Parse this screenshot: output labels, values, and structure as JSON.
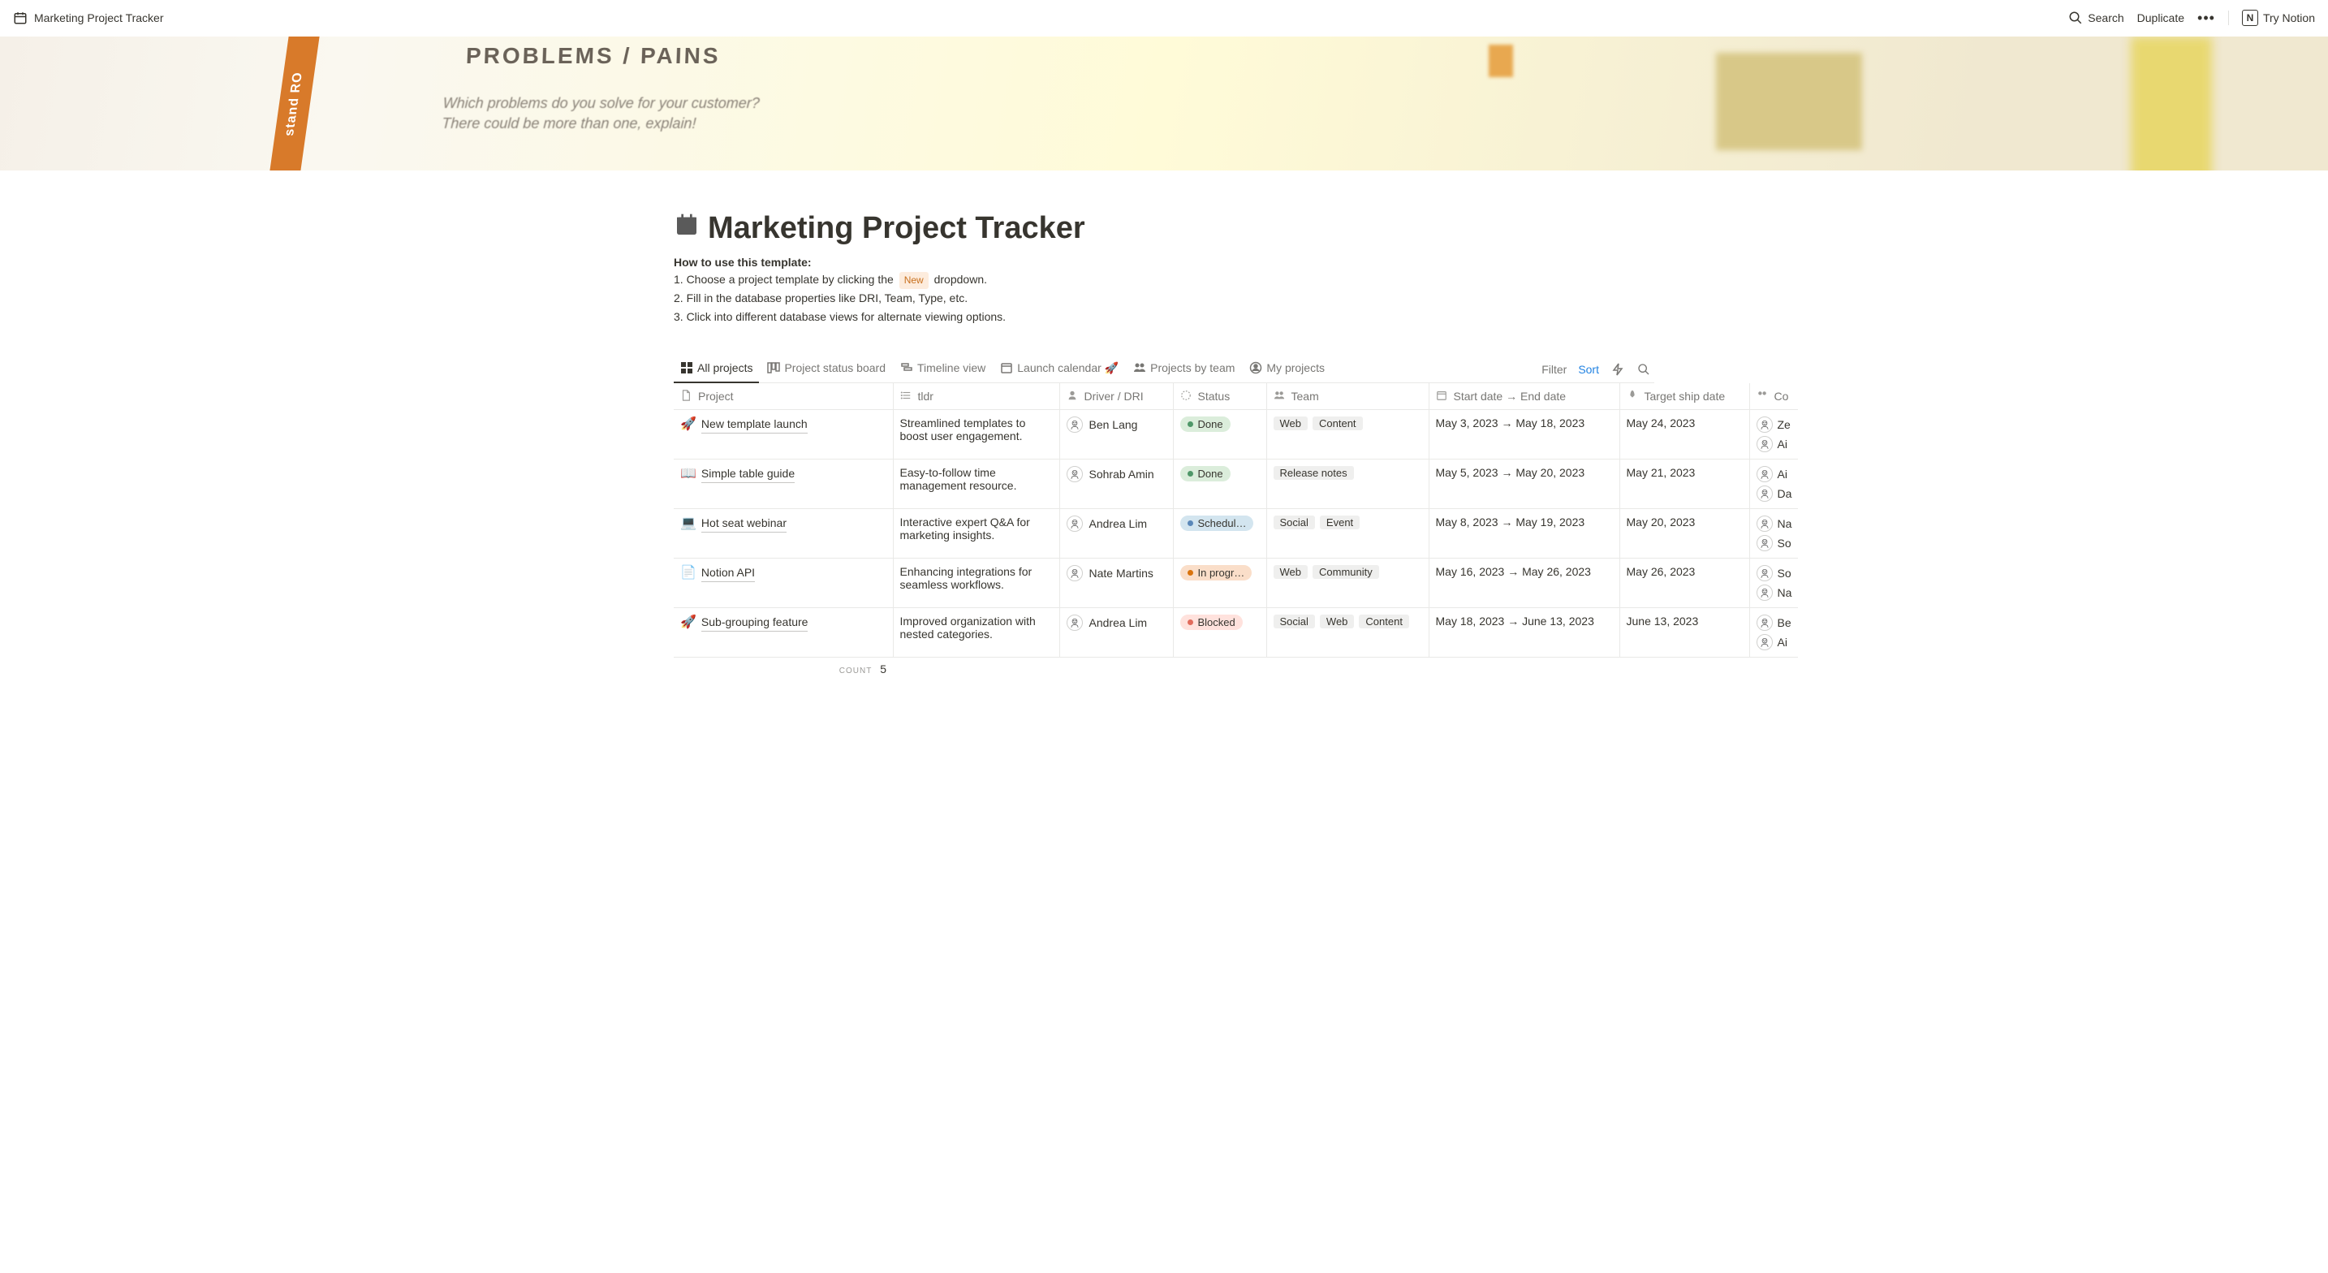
{
  "topbar": {
    "breadcrumb": "Marketing Project Tracker",
    "search": "Search",
    "duplicate": "Duplicate",
    "try_notion": "Try Notion",
    "notion_glyph": "N"
  },
  "cover": {
    "heading": "PROBLEMS / PAINS",
    "line1": "Which problems do you solve for your customer?",
    "line2": "There could be more than one, explain!",
    "orange": "stand RO"
  },
  "page": {
    "title": "Marketing Project Tracker",
    "howto_title": "How to use this template:",
    "line1a": "1. Choose a project template by clicking the",
    "line1_chip": "New",
    "line1b": "dropdown.",
    "line2": "2. Fill in the database properties like DRI, Team, Type, etc.",
    "line3": "3. Click into different database views for alternate viewing options."
  },
  "tabs": {
    "all": "All projects",
    "board": "Project status board",
    "timeline": "Timeline view",
    "launch_cal": "Launch calendar 🚀",
    "by_team": "Projects by team",
    "my": "My projects",
    "filter": "Filter",
    "sort": "Sort"
  },
  "columns": {
    "project": "Project",
    "tldr": "tldr",
    "driver": "Driver / DRI",
    "status": "Status",
    "team": "Team",
    "dates": "Start date → End date",
    "ship": "Target ship date",
    "contrib": "Co"
  },
  "rows": [
    {
      "emoji": "🚀",
      "name": "New template launch",
      "tldr": "Streamlined templates to boost user engagement.",
      "driver": "Ben Lang",
      "status_class": "status-done",
      "status": "Done",
      "teams": [
        "Web",
        "Content"
      ],
      "dates": "May 3, 2023 → May 18, 2023",
      "ship": "May 24, 2023",
      "contribs": [
        "Ze",
        "Ai"
      ]
    },
    {
      "emoji": "📖",
      "name": "Simple table guide",
      "tldr": "Easy-to-follow time management resource.",
      "driver": "Sohrab Amin",
      "status_class": "status-done",
      "status": "Done",
      "teams": [
        "Release notes"
      ],
      "dates": "May 5, 2023 → May 20, 2023",
      "ship": "May 21, 2023",
      "contribs": [
        "Ai",
        "Da"
      ]
    },
    {
      "emoji": "💻",
      "name": "Hot seat webinar",
      "tldr": "Interactive expert Q&A for marketing insights.",
      "driver": "Andrea Lim",
      "status_class": "status-scheduled",
      "status": "Schedul…",
      "teams": [
        "Social",
        "Event"
      ],
      "dates": "May 8, 2023 → May 19, 2023",
      "ship": "May 20, 2023",
      "contribs": [
        "Na",
        "So"
      ]
    },
    {
      "emoji": "📄",
      "name": "Notion API",
      "tldr": "Enhancing integrations for seamless workflows.",
      "driver": "Nate Martins",
      "status_class": "status-progress",
      "status": "In progr…",
      "teams": [
        "Web",
        "Community"
      ],
      "dates": "May 16, 2023 → May 26, 2023",
      "ship": "May 26, 2023",
      "contribs": [
        "So",
        "Na"
      ]
    },
    {
      "emoji": "🚀",
      "name": "Sub-grouping feature",
      "tldr": "Improved organization with nested categories.",
      "driver": "Andrea Lim",
      "status_class": "status-blocked",
      "status": "Blocked",
      "teams": [
        "Social",
        "Web",
        "Content"
      ],
      "dates": "May 18, 2023 → June 13, 2023",
      "ship": "June 13, 2023",
      "contribs": [
        "Be",
        "Ai"
      ]
    }
  ],
  "footer": {
    "count_label": "COUNT",
    "count_value": "5"
  }
}
